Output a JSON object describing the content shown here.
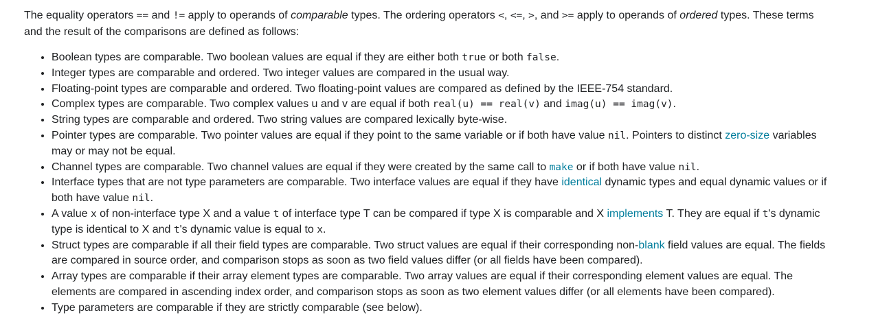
{
  "intro": {
    "t1": "The equality operators ",
    "op_eq": "==",
    "t2": " and ",
    "op_ne": "!=",
    "t3": " apply to operands of ",
    "em_comparable": "comparable",
    "t4": " types. The ordering operators ",
    "op_lt": "<",
    "t5": ", ",
    "op_le": "<=",
    "t6": ", ",
    "op_gt": ">",
    "t7": ", and ",
    "op_ge": ">=",
    "t8": " apply to operands of ",
    "em_ordered": "ordered",
    "t9": " types. These terms and the result of the comparisons are defined as follows:"
  },
  "rules": {
    "boolean": {
      "t1": "Boolean types are comparable. Two boolean values are equal if they are either both ",
      "c1": "true",
      "t2": " or both ",
      "c2": "false",
      "t3": "."
    },
    "integer": {
      "t1": "Integer types are comparable and ordered. Two integer values are compared in the usual way."
    },
    "float": {
      "t1": "Floating-point types are comparable and ordered. Two floating-point values are compared as defined by the IEEE-754 standard."
    },
    "complex": {
      "t1": "Complex types are comparable. Two complex values u and v are equal if both ",
      "c1": "real(u) == real(v)",
      "t2": " and ",
      "c2": "imag(u) == imag(v)",
      "t3": "."
    },
    "string": {
      "t1": "String types are comparable and ordered. Two string values are compared lexically byte-wise."
    },
    "pointer": {
      "t1": "Pointer types are comparable. Two pointer values are equal if they point to the same variable or if both have value ",
      "c1": "nil",
      "t2": ". Pointers to distinct ",
      "link1": "zero-size",
      "t3": " variables may or may not be equal."
    },
    "channel": {
      "t1": "Channel types are comparable. Two channel values are equal if they were created by the same call to ",
      "link1": "make",
      "t2": " or if both have value ",
      "c1": "nil",
      "t3": "."
    },
    "interface": {
      "t1": "Interface types that are not type parameters are comparable. Two interface values are equal if they have ",
      "link1": "identical",
      "t2": " dynamic types and equal dynamic values or if both have value ",
      "c1": "nil",
      "t3": "."
    },
    "mixed": {
      "t1": "A value ",
      "c1": "x",
      "t2": " of non-interface type X and a value ",
      "c2": "t",
      "t3": " of interface type T can be compared if type X is comparable and X ",
      "link1": "implements",
      "t4": " T. They are equal if ",
      "c3": "t",
      "t5": "'s dynamic type is identical to X and ",
      "c4": "t",
      "t6": "'s dynamic value is equal to ",
      "c5": "x",
      "t7": "."
    },
    "struct": {
      "t1": "Struct types are comparable if all their field types are comparable. Two struct values are equal if their corresponding non-",
      "link1": "blank",
      "t2": " field values are equal. The fields are compared in source order, and comparison stops as soon as two field values differ (or all fields have been compared)."
    },
    "array": {
      "t1": "Array types are comparable if their array element types are comparable. Two array values are equal if their corresponding element values are equal. The elements are compared in ascending index order, and comparison stops as soon as two element values differ (or all elements have been compared)."
    },
    "typeparam": {
      "t1": "Type parameters are comparable if they are strictly comparable (see below)."
    }
  }
}
